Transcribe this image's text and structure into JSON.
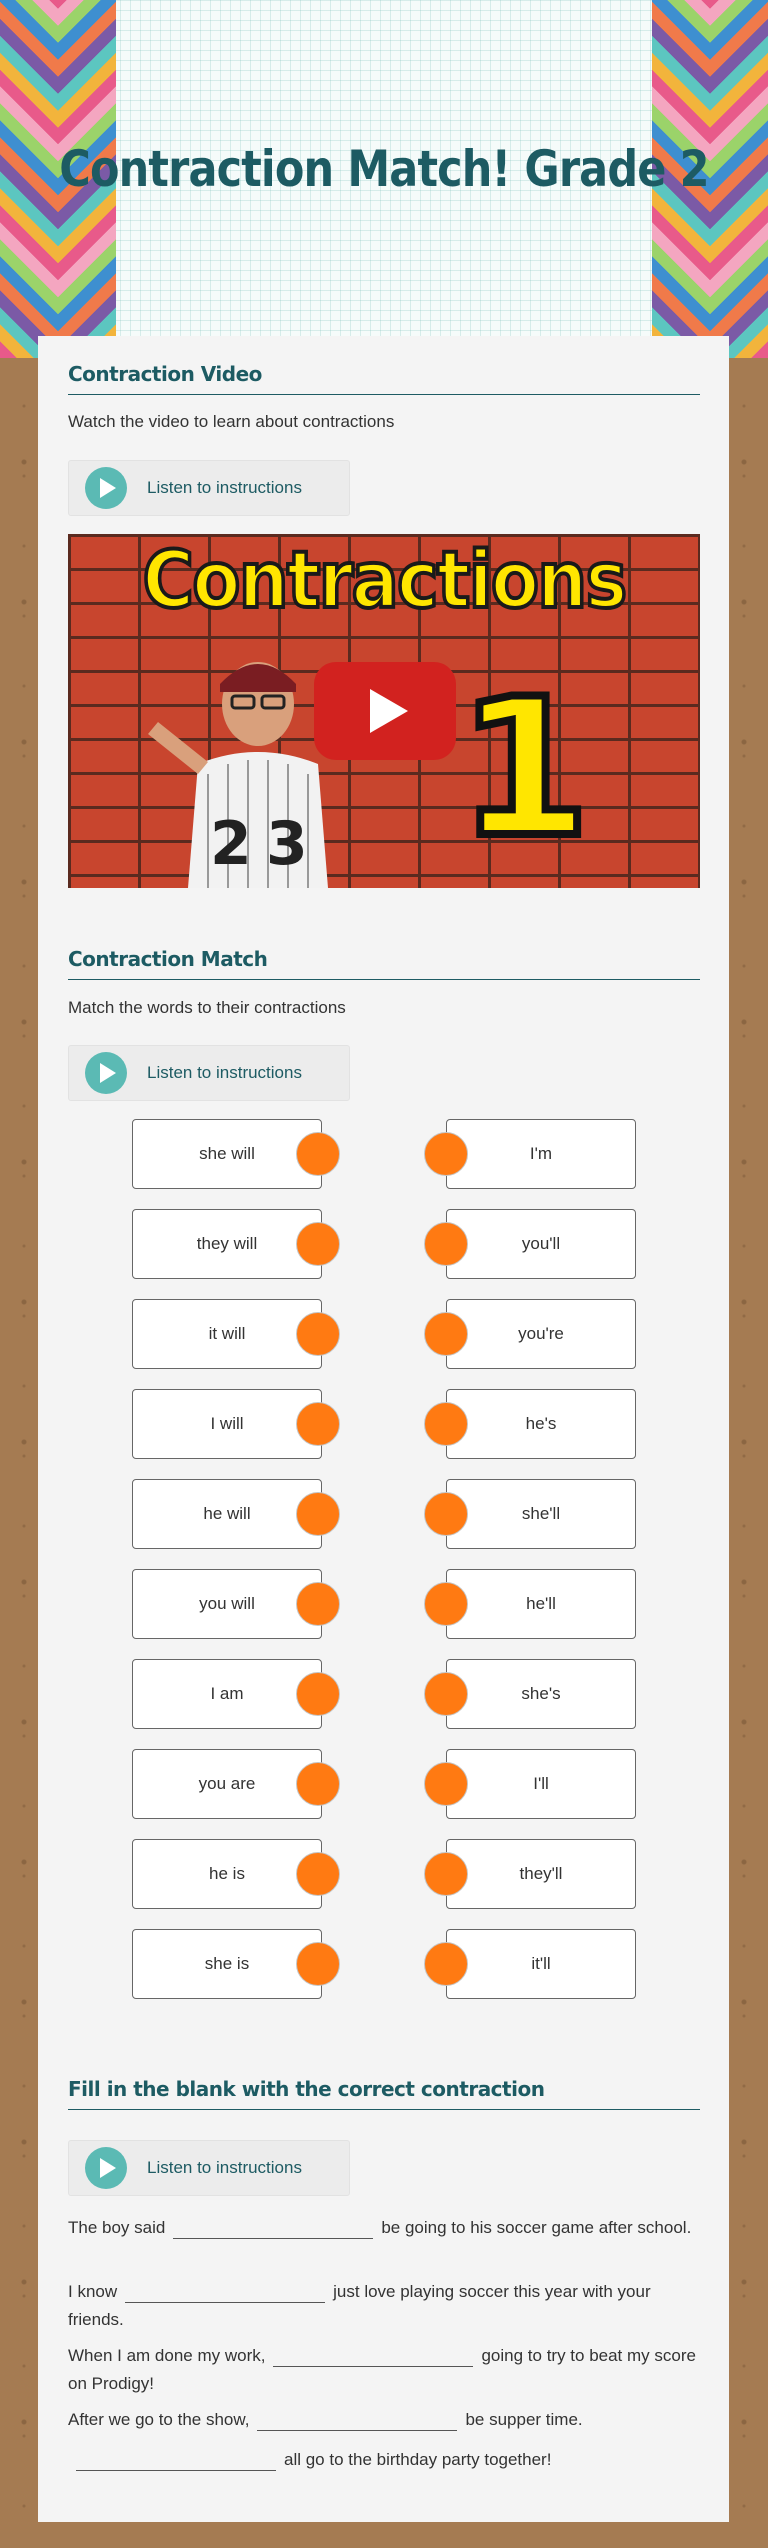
{
  "page_title": "Contraction Match! Grade 2",
  "sections": {
    "video": {
      "title": "Contraction Video",
      "description": "Watch the video to learn about contractions",
      "listen_label": "Listen to instructions",
      "video_title_text": "Contractions",
      "video_number_text": "1"
    },
    "match": {
      "title": "Contraction Match",
      "description": "Match the words to their contractions",
      "listen_label": "Listen to instructions",
      "left_items": [
        "she will",
        "they will",
        "it will",
        "I will",
        "he will",
        "you will",
        "I am",
        "you are",
        "he is",
        "she is"
      ],
      "right_items": [
        "I'm",
        "you'll",
        "you're",
        "he's",
        "she'll",
        "he'll",
        "she's",
        "I'll",
        "they'll",
        "it'll"
      ],
      "dot_color": "#ff7a12"
    },
    "fill": {
      "title": "Fill in the blank with the correct contraction",
      "listen_label": "Listen to instructions",
      "sentences": [
        {
          "before": "The boy said",
          "after": "be going to his soccer game after school."
        },
        {
          "before": "I know",
          "after": "just love playing soccer this year with your friends."
        },
        {
          "before": "When I am done my work,",
          "after": "going to try to beat my score on Prodigy!"
        },
        {
          "before": "After we go to the show,",
          "after": "be supper time."
        },
        {
          "before": "",
          "after": "all go to the birthday party together!"
        }
      ]
    }
  },
  "colors": {
    "title": "#1d5b63",
    "accent_teal": "#5bbab4",
    "youtube_red": "#d2221f"
  }
}
